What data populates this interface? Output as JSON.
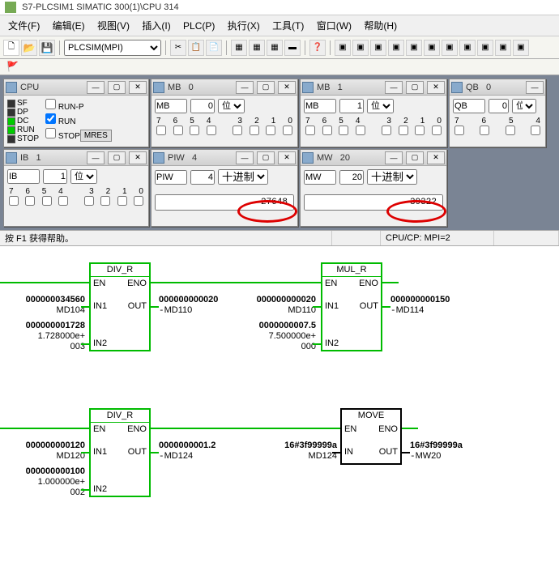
{
  "title": "S7-PLCSIM1   SIMATIC 300(1)\\CPU 314",
  "menu": [
    "文件(F)",
    "编辑(E)",
    "视图(V)",
    "插入(I)",
    "PLC(P)",
    "执行(X)",
    "工具(T)",
    "窗口(W)",
    "帮助(H)"
  ],
  "combo": "PLCSIM(MPI)",
  "cpu": {
    "title": "CPU",
    "leds": [
      "SF",
      "DP",
      "DC",
      "RUN",
      "STOP"
    ],
    "runp": "RUN-P",
    "run": "RUN",
    "stop": "STOP",
    "mres": "MRES"
  },
  "mb0": {
    "title": "MB   0",
    "type": "MB",
    "addr": "0",
    "fmt": "位",
    "bits": [
      "7",
      "6",
      "5",
      "4",
      "3",
      "2",
      "1",
      "0"
    ]
  },
  "mb1": {
    "title": "MB   1",
    "type": "MB",
    "addr": "1",
    "fmt": "位",
    "bits": [
      "7",
      "6",
      "5",
      "4",
      "3",
      "2",
      "1",
      "0"
    ]
  },
  "qb0": {
    "title": "QB   0",
    "type": "QB",
    "addr": "0",
    "fmt": "位",
    "bits": [
      "7",
      "6",
      "5",
      "4"
    ]
  },
  "ib1": {
    "title": "IB   1",
    "type": "IB",
    "addr": "1",
    "fmt": "位",
    "bits": [
      "7",
      "6",
      "5",
      "4",
      "3",
      "2",
      "1",
      "0"
    ]
  },
  "piw4": {
    "title": "PIW   4",
    "type": "PIW",
    "addr": "4",
    "fmt": "十进制",
    "value": "27648"
  },
  "mw20": {
    "title": "MW   20",
    "type": "MW",
    "addr": "20",
    "fmt": "十进制",
    "value": "39322"
  },
  "status": {
    "help": "按 F1 获得帮助。",
    "cpu": "CPU/CP: MPI=2"
  },
  "net1": {
    "b1": {
      "title": "DIV_R",
      "en": "EN",
      "eno": "ENO",
      "in1": "IN1",
      "in2": "IN2",
      "out": "OUT"
    },
    "b2": {
      "title": "MUL_R",
      "en": "EN",
      "eno": "ENO",
      "in1": "IN1",
      "in2": "IN2",
      "out": "OUT"
    },
    "in1a": "000000034560",
    "in1b": "MD104",
    "in2a": "000000001728",
    "in2b": "1.728000e+",
    "in2c": "003",
    "out1a": "000000000020",
    "out1b": "MD110",
    "mul_in1a": "000000000020",
    "mul_in1b": "MD110",
    "mul_in2a": "0000000007.5",
    "mul_in2b": "7.500000e+",
    "mul_in2c": "000",
    "mul_outa": "000000000150",
    "mul_outb": "MD114"
  },
  "net2": {
    "b1": {
      "title": "DIV_R",
      "en": "EN",
      "eno": "ENO",
      "in1": "IN1",
      "in2": "IN2",
      "out": "OUT"
    },
    "b2": {
      "title": "MOVE",
      "en": "EN",
      "eno": "ENO",
      "in": "IN",
      "out": "OUT"
    },
    "in1a": "000000000120",
    "in1b": "MD120",
    "in2a": "000000000100",
    "in2b": "1.000000e+",
    "in2c": "002",
    "out1a": "0000000001.2",
    "out1b": "MD124",
    "mv_in1a": "16#3f99999a",
    "mv_in1b": "MD124",
    "mv_outa": "16#3f99999a",
    "mv_outb": "MW20"
  }
}
